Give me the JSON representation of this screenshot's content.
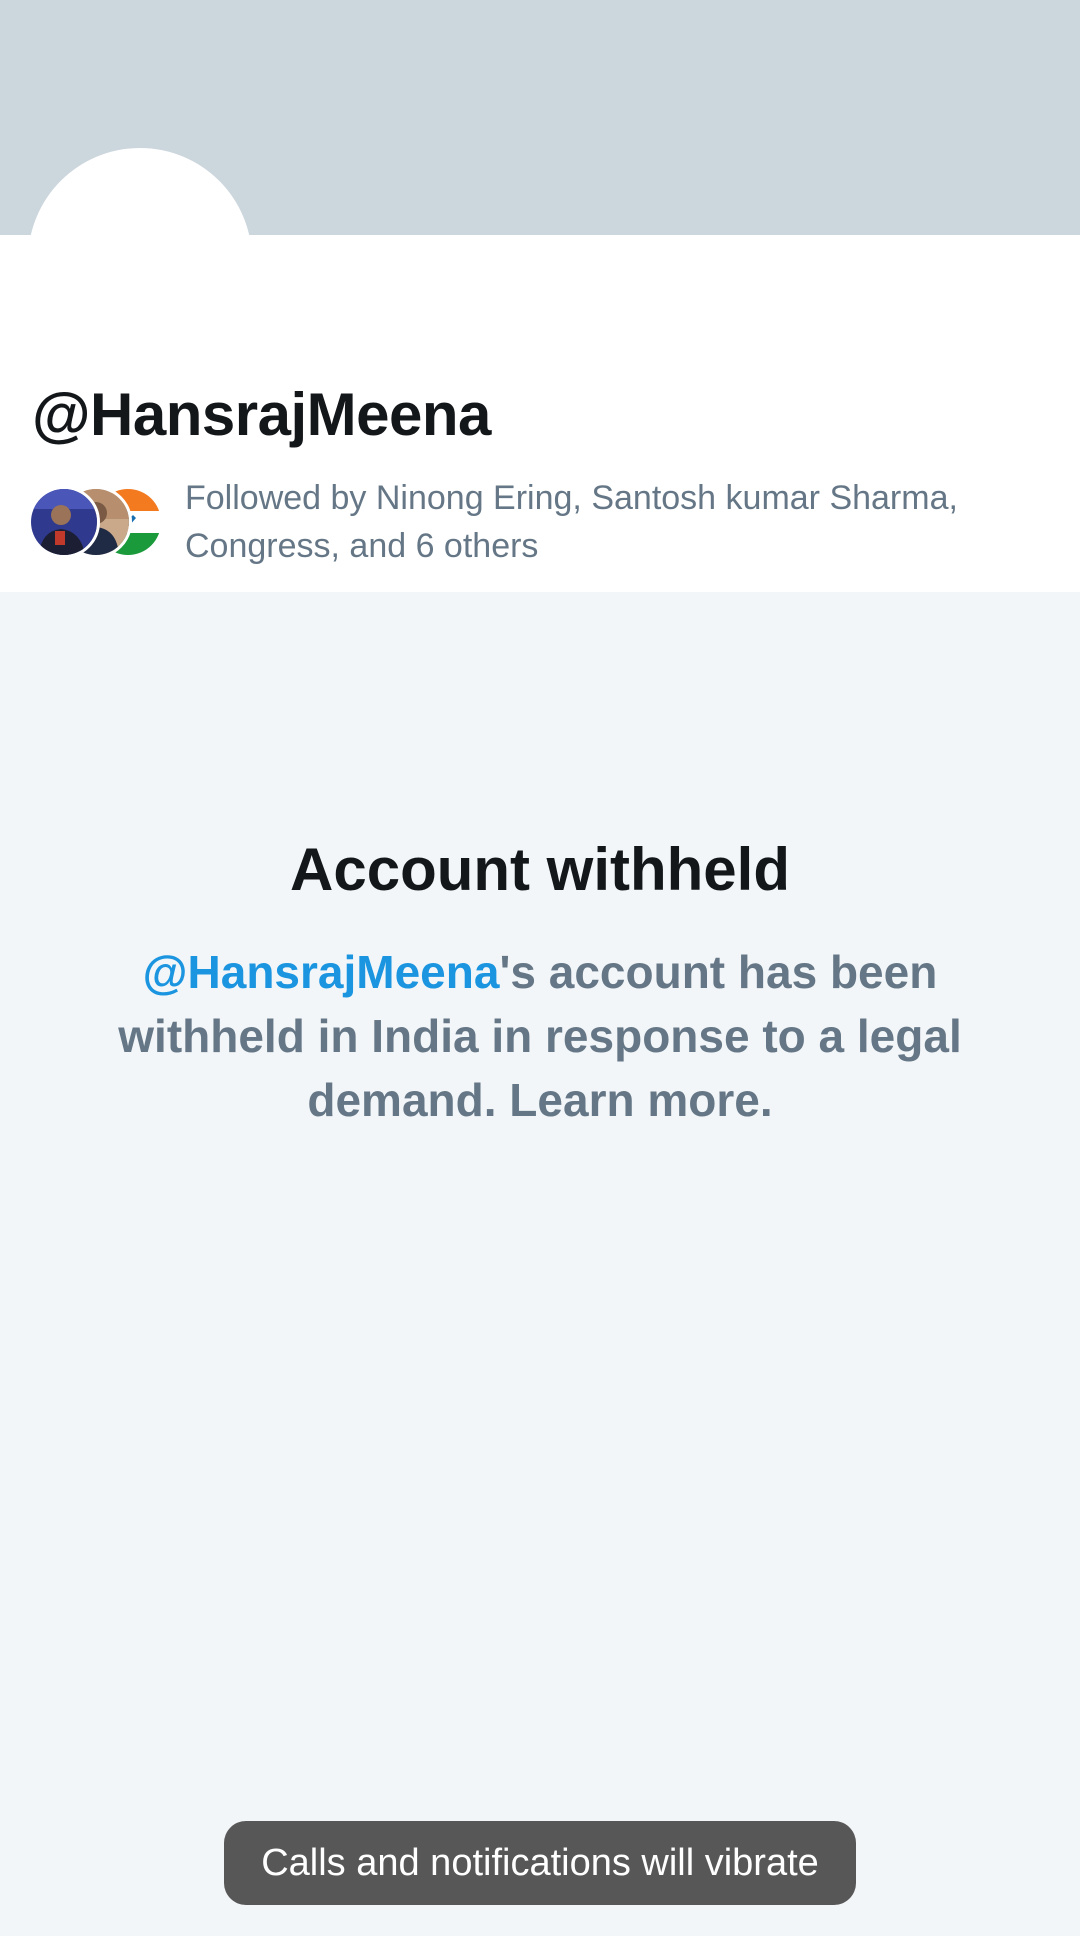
{
  "profile": {
    "handle": "@HansrajMeena",
    "followed_by": "Followed by Ninong Ering, Santosh kumar Sharma, Congress, and 6 others"
  },
  "withheld": {
    "title": "Account withheld",
    "mention": "@HansrajMeena",
    "message": "'s account has been withheld in India in response to a legal demand. Learn more."
  },
  "toast": {
    "text": "Calls and notifications will vibrate"
  },
  "colors": {
    "banner": "#ccd6dd",
    "link": "#1b95e0",
    "secondary_text": "#657786",
    "background": "#f3f6f9"
  }
}
